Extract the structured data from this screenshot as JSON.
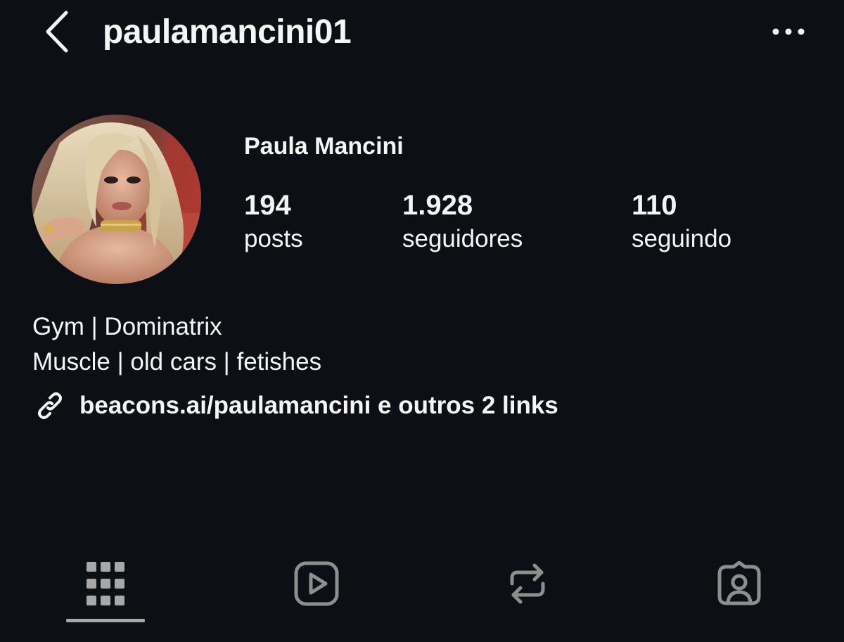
{
  "header": {
    "username": "paulamancini01",
    "back_icon": "chevron-left-icon",
    "more_icon": "more-horizontal-icon"
  },
  "profile": {
    "display_name": "Paula Mancini",
    "avatar": "profile-photo",
    "stats": [
      {
        "value": "194",
        "label": "posts"
      },
      {
        "value": "1.928",
        "label": "seguidores"
      },
      {
        "value": "110",
        "label": "seguindo"
      }
    ],
    "bio_lines": [
      "Gym | Dominatrix",
      "Muscle | old cars | fetishes"
    ],
    "link": {
      "icon": "link-icon",
      "text": "beacons.ai/paulamancini e outros 2 links"
    }
  },
  "tabs": [
    {
      "name": "grid",
      "icon": "grid-icon",
      "active": true
    },
    {
      "name": "reels",
      "icon": "reels-icon",
      "active": false
    },
    {
      "name": "reposts",
      "icon": "repost-icon",
      "active": false
    },
    {
      "name": "tagged",
      "icon": "tagged-icon",
      "active": false
    }
  ],
  "colors": {
    "background": "#0c1014",
    "text": "#f5f5f5",
    "icon_muted": "#a8a8a8",
    "tab_icon_inactive": "#8e8e8e"
  }
}
